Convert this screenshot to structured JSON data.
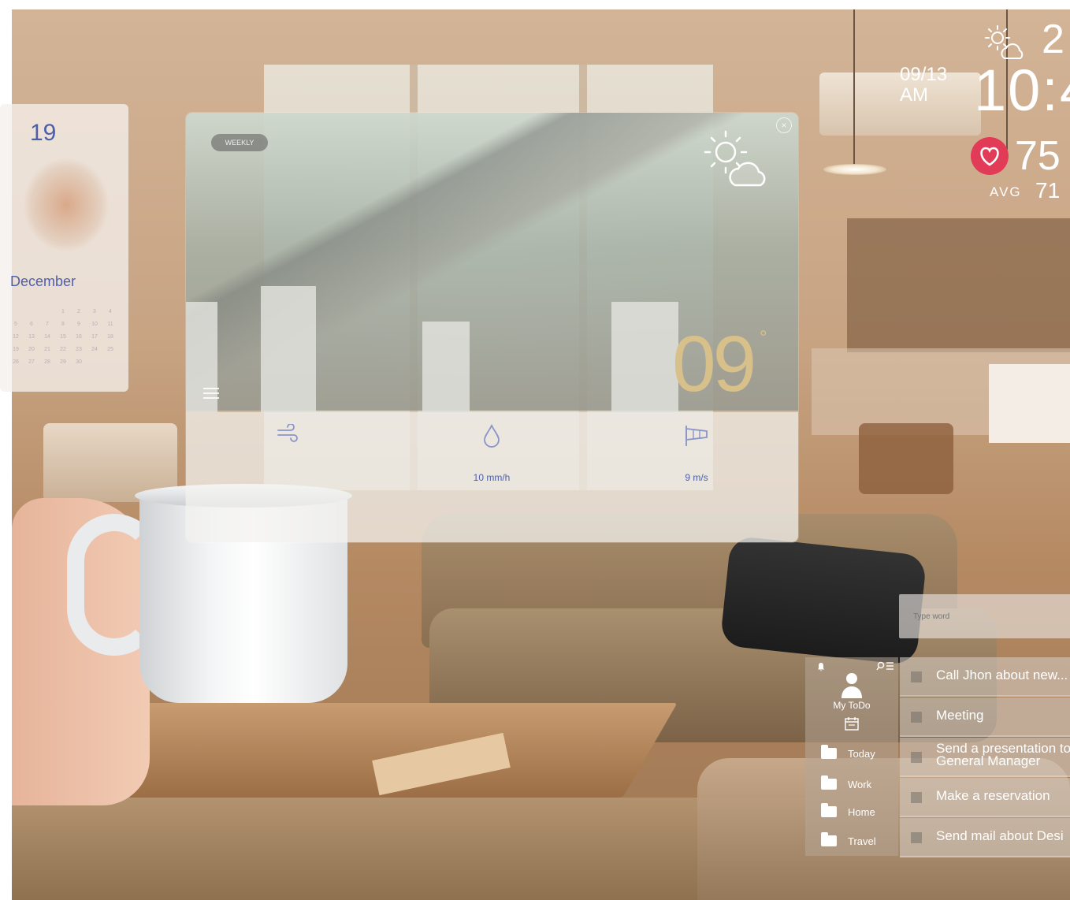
{
  "calendar": {
    "day": "19",
    "month": "December",
    "grid_days": [
      "",
      "",
      "",
      "1",
      "2",
      "3",
      "4",
      "5",
      "6",
      "7",
      "8",
      "9",
      "10",
      "11",
      "12",
      "13",
      "14",
      "15",
      "16",
      "17",
      "18",
      "19",
      "20",
      "21",
      "22",
      "23",
      "24",
      "25",
      "26",
      "27",
      "28",
      "29",
      "30",
      "",
      ""
    ]
  },
  "weather": {
    "tab_label": "WEEKLY",
    "temperature": "09",
    "degree_symbol": "°",
    "icon": "sun-cloud-icon",
    "stats": [
      {
        "icon": "wind-icon",
        "value": ""
      },
      {
        "icon": "raindrop-icon",
        "value": "10 mm/h"
      },
      {
        "icon": "windsock-icon",
        "value": "9 m/s"
      }
    ]
  },
  "status": {
    "weather_icon": "sun-cloud-icon",
    "temperature_partial": "2",
    "date": "09/13",
    "meridiem": "AM",
    "time_partial": "10:4",
    "heart_rate_partial": "75",
    "avg_label": "AVG",
    "avg_value": "71"
  },
  "colors": {
    "accent_blue": "#4c5fa8",
    "temperature_gold": "#d8c08a",
    "heart_red": "#e23b57"
  },
  "todo": {
    "search_placeholder": "Type word",
    "user_label": "My ToDo",
    "categories": [
      "Today",
      "Work",
      "Home",
      "Travel"
    ],
    "items": [
      "Call Jhon about new...",
      "Meeting",
      "Send a presentation to General Manager",
      "Make a reservation",
      "Send mail about Desi"
    ]
  }
}
